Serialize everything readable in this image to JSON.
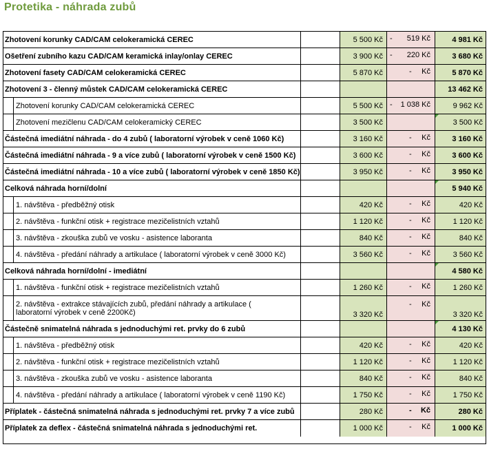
{
  "title": "Protetika -  náhrada zubů",
  "rows": [
    {
      "label": "Zhotovení korunky CAD/CAM  celokeramická CEREC",
      "bold": true,
      "price": "5 500 Kč",
      "dash": "-",
      "discount": "519 Kč",
      "final": "4 981 Kč"
    },
    {
      "label": "Ošetření zubního kazu CAD/CAM keramická inlay/onlay CEREC",
      "bold": true,
      "price": "3 900 Kč",
      "dash": "-",
      "discount": "220 Kč",
      "final": "3 680 Kč"
    },
    {
      "label": "Zhotovení fasety CAD/CAM  celokeramická CEREC",
      "bold": true,
      "price": "5 870 Kč",
      "dash": "-",
      "discount": "Kč",
      "final": "5 870 Kč"
    },
    {
      "label": "Zhotovení 3 - členný můstek  CAD/CAM  celokeramická CEREC",
      "bold": true,
      "price": "",
      "dash": "",
      "discount": "",
      "final": "13 462 Kč"
    },
    {
      "label": "Zhotovení korunky CAD/CAM celokeramická CEREC",
      "bold": false,
      "sub": true,
      "price": "5 500 Kč",
      "dash": "-",
      "discount": "1 038 Kč",
      "final": "9 962 Kč"
    },
    {
      "label": "Zhotovení mezičlenu CAD/CAM celokeramický CEREC",
      "bold": false,
      "sub": true,
      "price": "3 500 Kč",
      "dash": "",
      "discount": "",
      "final": "3 500 Kč"
    },
    {
      "label": "Částečná imediátní náhrada - do 4 zubů ( laboratorní výrobek v ceně 1060 Kč)",
      "bold": true,
      "price": "3 160 Kč",
      "dash": "-",
      "discount": "Kč",
      "final": "3 160 Kč"
    },
    {
      "label": "Částečná imediátní náhrada - 9 a více zubů ( laboratorní výrobek v ceně 1500 Kč)",
      "bold": true,
      "price": "3 600 Kč",
      "dash": "-",
      "discount": "Kč",
      "final": "3 600 Kč"
    },
    {
      "label": "Částečná imediátní náhrada - 10 a více zubů ( laboratorní výrobek v ceně 1850 Kč)",
      "bold": true,
      "price": "3 950 Kč",
      "dash": "-",
      "discount": "Kč",
      "final": "3 950 Kč"
    },
    {
      "label": "Celková náhrada horní/dolní",
      "bold": true,
      "price": "",
      "dash": "",
      "discount": "",
      "final": "5 940 Kč"
    },
    {
      "label": "1. návštěva - předběžný otisk",
      "bold": false,
      "sub": true,
      "price": "420 Kč",
      "dash": "-",
      "discount": "Kč",
      "final": "420 Kč"
    },
    {
      "label": "2. návštěva - funkční otisk + registrace mezičelistních vztahů",
      "bold": false,
      "sub": true,
      "price": "1 120 Kč",
      "dash": "-",
      "discount": "Kč",
      "final": "1 120 Kč"
    },
    {
      "label": "3. návštěva - zkouška zubů ve vosku - asistence laboranta",
      "bold": false,
      "sub": true,
      "price": "840 Kč",
      "dash": "-",
      "discount": "Kč",
      "final": "840 Kč"
    },
    {
      "label": "4. návštěva - předání náhrady a artikulace ( laboratorní výrobek v ceně 3000 Kč)",
      "bold": false,
      "sub": true,
      "price": "3 560 Kč",
      "dash": "-",
      "discount": "Kč",
      "final": "3 560 Kč"
    },
    {
      "label": "Celková  náhrada horní/dolní - imediátní",
      "bold": true,
      "price": "",
      "dash": "",
      "discount": "",
      "final": "4 580 Kč"
    },
    {
      "label": "1. návštěva - funkční otisk + registrace mezičelistních vztahů",
      "bold": false,
      "sub": true,
      "price": "1 260 Kč",
      "dash": "-",
      "discount": "Kč",
      "final": "1 260 Kč"
    },
    {
      "label": "2. návštěva - extrakce stávajících zubů, předání náhrady a artikulace (",
      "label2": "laboratorní výrobek v ceně 2200Kč)",
      "bold": false,
      "sub": true,
      "price": "3 320 Kč",
      "dash": "-",
      "discount": "Kč",
      "final": "3 320 Kč"
    },
    {
      "label": "Částečně snimatelná náhrada s jednoduchými ret. prvky do 6 zubů",
      "bold": true,
      "price": "",
      "dash": "",
      "discount": "",
      "final": "4 130 Kč"
    },
    {
      "label": "1. návštěva - předběžný otisk",
      "bold": false,
      "sub": true,
      "price": "420 Kč",
      "dash": "-",
      "discount": "Kč",
      "final": "420 Kč"
    },
    {
      "label": "2. návštěva - funkční otisk + registrace mezičelistních vztahů",
      "bold": false,
      "sub": true,
      "price": "1 120 Kč",
      "dash": "-",
      "discount": "Kč",
      "final": "1 120 Kč"
    },
    {
      "label": "3. návštěva - zkouška zubů ve vosku - asistence laboranta",
      "bold": false,
      "sub": true,
      "price": "840 Kč",
      "dash": "-",
      "discount": "Kč",
      "final": "840 Kč"
    },
    {
      "label": "4. návštěva - předání náhrady a artikulace ( laboratorní výrobek v ceně 1190 Kč)",
      "bold": false,
      "sub": true,
      "price": "1 750 Kč",
      "dash": "-",
      "discount": "Kč",
      "final": "1 750 Kč"
    },
    {
      "label": "Příplatek - částečná snimatelná náhrada s jednoduchými ret. prvky 7 a více zubů",
      "bold": true,
      "price": "280 Kč",
      "dash": "-",
      "discount": "Kč",
      "final": "280 Kč",
      "discBold": true
    },
    {
      "label": "Příplatek za deflex - částečná snimatelná náhrada s jednoduchými ret.",
      "bold": true,
      "price": "1 000 Kč",
      "dash": "-",
      "discount": "Kč",
      "final": "1 000 Kč"
    }
  ]
}
